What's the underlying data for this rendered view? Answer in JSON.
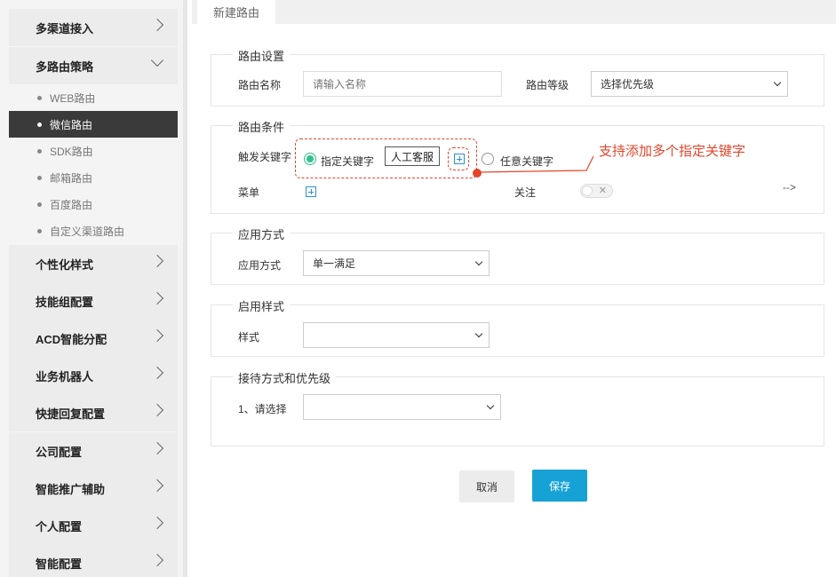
{
  "sidebar": {
    "items": [
      {
        "label": "多渠道接入"
      },
      {
        "label": "多路由策略"
      },
      {
        "label": "个性化样式"
      },
      {
        "label": "技能组配置"
      },
      {
        "label": "ACD智能分配"
      },
      {
        "label": "业务机器人"
      },
      {
        "label": "快捷回复配置"
      },
      {
        "label": "公司配置"
      },
      {
        "label": "智能推广辅助"
      },
      {
        "label": "个人配置"
      },
      {
        "label": "智能配置"
      }
    ],
    "subitems": [
      {
        "label": "WEB路由"
      },
      {
        "label": "微信路由"
      },
      {
        "label": "SDK路由"
      },
      {
        "label": "邮箱路由"
      },
      {
        "label": "百度路由"
      },
      {
        "label": "自定义渠道路由"
      }
    ],
    "active_subitem": "微信路由"
  },
  "tab": {
    "label": "新建路由"
  },
  "route_settings": {
    "title": "路由设置",
    "name_label": "路由名称",
    "name_placeholder": "请输入名称",
    "level_label": "路由等级",
    "level_value": "选择优先级"
  },
  "route_conditions": {
    "title": "路由条件",
    "trigger_label": "触发关键字",
    "option_specified": "指定关键字",
    "keyword_tag": "人工客服",
    "option_any": "任意关键字",
    "menu_label": "菜单",
    "follow_label": "关注",
    "toggle_off_mark": "✕",
    "arrow_text": "-->"
  },
  "annotation": {
    "text": "支持添加多个指定关键字",
    "color": "#e2452b"
  },
  "apply_mode": {
    "title": "应用方式",
    "label": "应用方式",
    "value": "单一满足"
  },
  "enable_style": {
    "title": "启用样式",
    "label": "样式",
    "value": ""
  },
  "reception": {
    "title": "接待方式和优先级",
    "label": "1、请选择",
    "value": ""
  },
  "buttons": {
    "cancel": "取消",
    "save": "保存"
  },
  "colors": {
    "accent": "#17a2d6",
    "radio_on": "#2ec28a",
    "sidebar_active": "#3a3a3a"
  }
}
